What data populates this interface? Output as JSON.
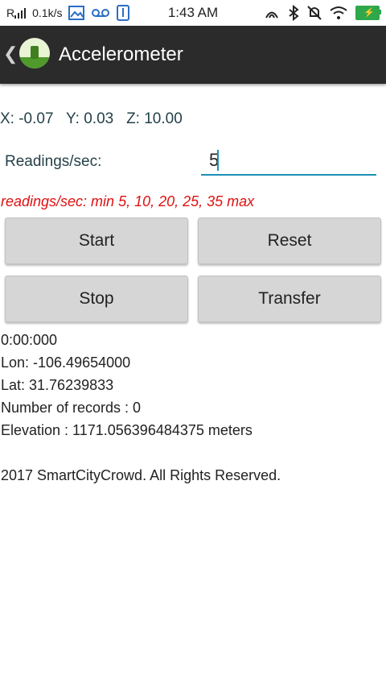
{
  "status_bar": {
    "signal": "R",
    "speed": "0.1k/s",
    "time": "1:43 AM"
  },
  "action_bar": {
    "title": "Accelerometer"
  },
  "sensor": {
    "x_label": "X:",
    "x": "-0.07",
    "y_label": "Y:",
    "y": "0.03",
    "z_label": "Z:",
    "z": "10.00"
  },
  "readings": {
    "label": "Readings/sec:",
    "value": "5",
    "hint": "readings/sec: min 5, 10, 20, 25, 35 max"
  },
  "buttons": {
    "start": "Start",
    "reset": "Reset",
    "stop": "Stop",
    "transfer": "Transfer"
  },
  "info": {
    "timer": "0:00:000",
    "lon": "Lon: -106.49654000",
    "lat": "Lat: 31.76239833",
    "records": "Number of records : 0",
    "elevation": "Elevation : 1171.056396484375 meters",
    "copyright": "2017 SmartCityCrowd. All Rights Reserved."
  },
  "colors": {
    "accent": "#1c8fb5",
    "hint_red": "#e01010",
    "actionbar": "#2b2b2b",
    "battery_green": "#2ea84a"
  },
  "icons": [
    "signal-icon",
    "image-icon",
    "voicemail-icon",
    "usb-icon",
    "nfc-icon",
    "bluetooth-icon",
    "mute-icon",
    "wifi-icon",
    "battery-icon"
  ]
}
